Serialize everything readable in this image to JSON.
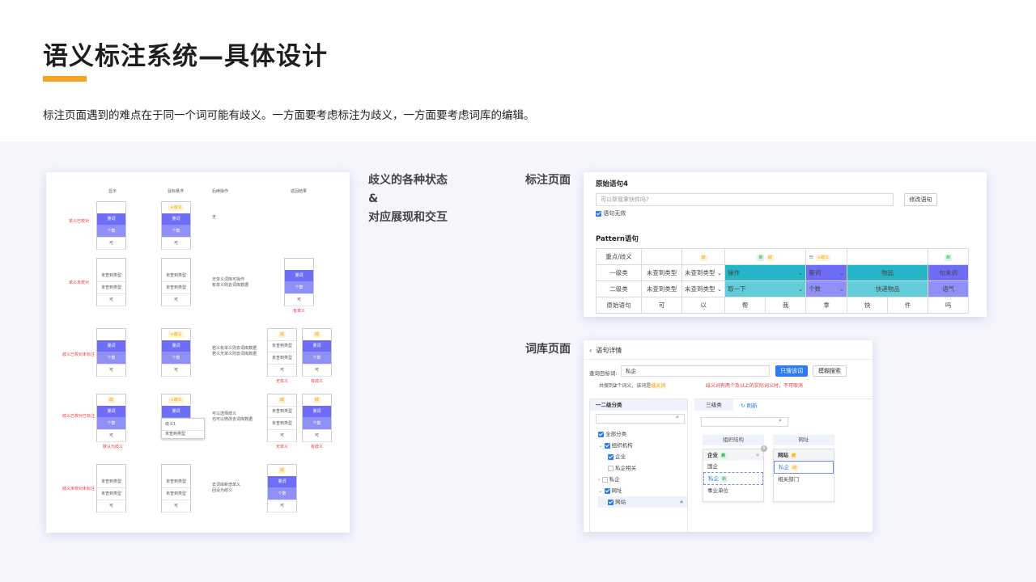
{
  "header": {
    "title": "语义标注系统—具体设计",
    "subtitle": "标注页面遇到的难点在于同一个词可能有歧义。一方面要考虑标注为歧义，一方面要考虑词库的编辑。"
  },
  "labels": {
    "states_line1": "歧义的各种状态",
    "states_line2": "&",
    "states_line3": "对应展现和交互",
    "annot_page": "标注页面",
    "lexicon_page": "词库页面"
  },
  "left_card": {
    "col_headers": [
      "显示",
      "鼠标悬浮",
      "后续操作",
      "返回结果"
    ],
    "row_labels": [
      "单义已校对",
      "单义未校对",
      "歧义已校对未标注",
      "歧义已校对已标注",
      "歧义未校对未标注"
    ],
    "ops": [
      "无",
      "无单义词库可操作\n有单义则去词库数据",
      "若义有单义则去词库数据\n若义无单义则去词库数据",
      "可以选择歧义\n也可以修改去词库数据",
      "去词库新增单义\n回设为歧义"
    ],
    "cells": {
      "liang_ci": "量词",
      "ge_shu": "个数",
      "ke": "可",
      "wei_cha": "未查到类型",
      "qiyi_tag": "+歧义",
      "dan_tag": "歧",
      "result_tag": "有单义",
      "no_single": "无单义",
      "has_single": "有单义",
      "no_single2": "无单义",
      "has_single2": "有歧义",
      "set_qiyi": "默认为歧义",
      "qiyi1": "歧义1",
      "wei_cha2": "未查到类型"
    }
  },
  "annot": {
    "section1": "原始语句4",
    "input_placeholder": "可以帮我拿快件吗?",
    "modify_btn": "修改语句",
    "invalid_check": "语句无效",
    "section2": "Pattern语句",
    "row_heads": [
      "重点/歧义",
      "一级类",
      "二级类",
      "原始语句"
    ],
    "tags": [
      "歧",
      "歧",
      "歧",
      "+歧义",
      "歧"
    ],
    "level1": [
      "未查到类型",
      "未查到类型",
      "操作",
      "量词",
      "物品",
      "句末词"
    ],
    "level2": [
      "未查到类型",
      "未查到类型",
      "取一下",
      "个数",
      "快递物品",
      "语气"
    ],
    "words": [
      "可",
      "以",
      "帮",
      "我",
      "拿",
      "快",
      "件",
      "吗"
    ]
  },
  "lexicon": {
    "back_title": "语句详情",
    "query_label": "查询目标词:",
    "query_value": "私企",
    "btn_exact": "只搜该词",
    "btn_fuzzy": "模糊搜索",
    "result_pre": "共搜到",
    "result_num": "2",
    "result_mid": "个词义，该词是",
    "result_flag": "歧义词",
    "warn": "歧义词有两个及以上的实际词义时，不可取消",
    "left_head": "一二级分类",
    "tab_l3": "三级类",
    "refresh": "刷新",
    "tree": [
      "全部分类",
      "组织机构",
      "企业",
      "私企相关",
      "私企",
      "网址",
      "网站"
    ],
    "col_a": "组织结构",
    "col_b": "网址",
    "card_a_title": "企业",
    "card_a_items": [
      "国企",
      "私企",
      "事业单位"
    ],
    "card_b_title": "网站",
    "card_b_items": [
      "私企",
      "相关部门"
    ],
    "tag_new": "新",
    "tag_qi": "歧"
  }
}
